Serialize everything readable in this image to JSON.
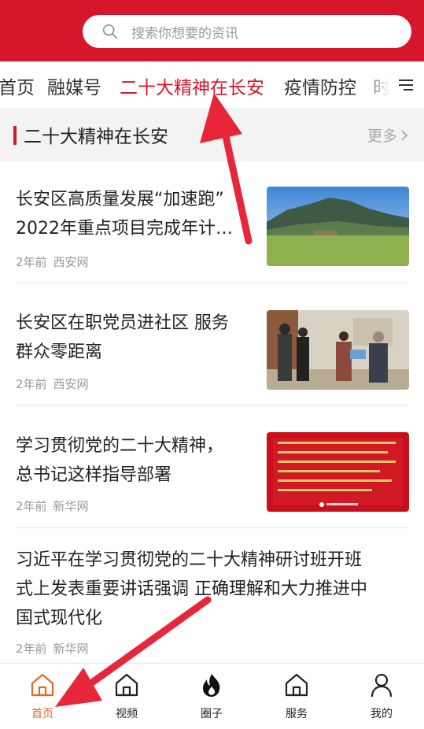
{
  "search": {
    "placeholder": "搜索你想要的资讯"
  },
  "tabs": [
    {
      "label": "首页",
      "active": false
    },
    {
      "label": "融媒号",
      "active": false
    },
    {
      "label": "二十大精神在长安",
      "active": true
    },
    {
      "label": "疫情防控",
      "active": false
    },
    {
      "label": "时",
      "active": false
    }
  ],
  "section": {
    "title": "二十大精神在长安",
    "more": "更多"
  },
  "news": [
    {
      "title_line1": "长安区高质量发展“加速跑”",
      "title_line2": "2022年重点项目完成年计…",
      "time": "2年前",
      "source": "西安网",
      "thumb": "landscape"
    },
    {
      "title_line1": "长安区在职党员进社区  服务",
      "title_line2": "群众零距离",
      "time": "2年前",
      "source": "西安网",
      "thumb": "volunteers"
    },
    {
      "title_line1": "学习贯彻党的二十大精神，",
      "title_line2": "总书记这样指导部署",
      "time": "2年前",
      "source": "新华网",
      "thumb": "red-poster"
    },
    {
      "title_line1": "习近平在学习贯彻党的二十大精神研讨班开班",
      "title_line2": "式上发表重要讲话强调  正确理解和大力推进中",
      "title_line3": "国式现代化",
      "time": "2年前",
      "source": "新华网"
    }
  ],
  "bottom_nav": [
    {
      "label": "首页",
      "icon": "home-icon",
      "active": true
    },
    {
      "label": "视频",
      "icon": "video-home-icon",
      "active": false
    },
    {
      "label": "圈子",
      "icon": "flame-icon",
      "active": false
    },
    {
      "label": "服务",
      "icon": "service-home-icon",
      "active": false
    },
    {
      "label": "我的",
      "icon": "user-icon",
      "active": false
    }
  ],
  "colors": {
    "brand": "#d6162b",
    "active_nav": "#e8681f",
    "annotation_arrow": "#e8263a"
  }
}
